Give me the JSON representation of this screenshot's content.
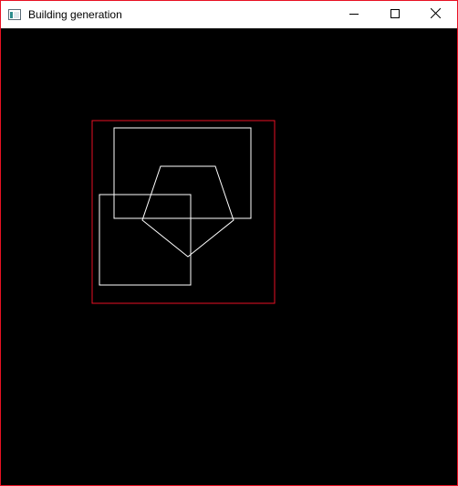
{
  "window": {
    "title": "Building generation",
    "frame_color": "#e81123"
  },
  "titlebar": {
    "icon": "app-window-icon",
    "buttons": [
      {
        "name": "minimize",
        "icon": "minimize-icon"
      },
      {
        "name": "maximize",
        "icon": "maximize-icon"
      },
      {
        "name": "close",
        "icon": "close-icon"
      }
    ]
  },
  "canvas": {
    "background": "#000000",
    "bounds_color": "#e81123",
    "shape_color": "#ffffff"
  }
}
